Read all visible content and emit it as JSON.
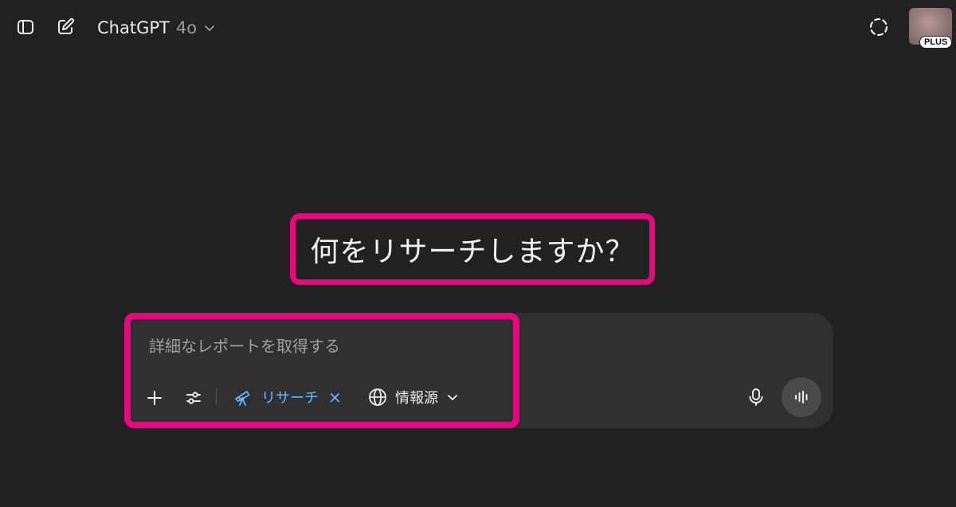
{
  "header": {
    "model_name": "ChatGPT",
    "model_version": "4o",
    "plan_badge": "PLUS",
    "icons": {
      "sidebar": "sidebar-toggle-icon",
      "new_chat": "new-chat-edit-icon",
      "model_menu": "chevron-down-icon",
      "temporary_chat": "dashed-circle-icon"
    }
  },
  "main": {
    "heading": "何をリサーチしますか？"
  },
  "composer": {
    "placeholder": "詳細なレポートを取得する",
    "value": "",
    "research_chip_label": "リサーチ",
    "research_chip_close": "×",
    "sources_label": "情報源"
  },
  "colors": {
    "background": "#212121",
    "composer": "#303030",
    "highlight": "#e5097f",
    "research_accent": "#66b6ff"
  }
}
